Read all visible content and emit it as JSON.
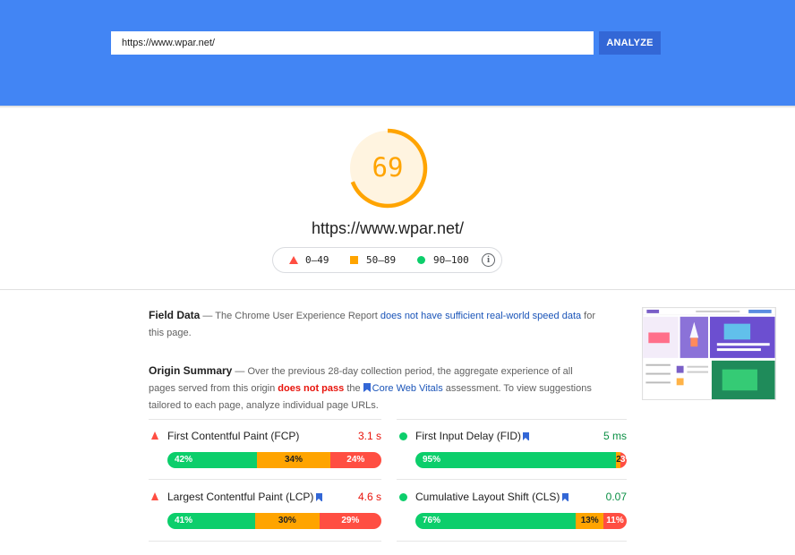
{
  "search": {
    "url_value": "https://www.wpar.net/",
    "analyze_label": "ANALYZE"
  },
  "score": {
    "value": "69",
    "fraction": 0.69,
    "color": "#ffa400",
    "track_color": "#fff4e0"
  },
  "page_url": "https://www.wpar.net/",
  "legend": {
    "poor_range": "0–49",
    "average_range": "50–89",
    "good_range": "90–100",
    "info_glyph": "i"
  },
  "field_data": {
    "title": "Field Data",
    "text_before": " — The Chrome User Experience Report ",
    "link_text": "does not have sufficient real-world speed data",
    "text_after": " for this page."
  },
  "origin_summary": {
    "title": "Origin Summary",
    "text_before": " — Over the previous 28-day collection period, the aggregate experience of all pages served from this origin ",
    "fail_text": "does not pass",
    "text_middle": " the ",
    "cwv_link": "Core Web Vitals",
    "text_after": " assessment. To view suggestions tailored to each page, analyze individual page URLs."
  },
  "metrics": {
    "fcp": {
      "label": "First Contentful Paint (FCP)",
      "value": "3.1 s",
      "status_icon": "triangle-icon",
      "good": "42%",
      "average": "34%",
      "poor": "24%",
      "good_pct": 42,
      "average_pct": 34,
      "poor_pct": 24
    },
    "fid": {
      "label": "First Input Delay (FID)",
      "value": "5 ms",
      "status_icon": "circle-icon",
      "good": "95%",
      "average": "2%",
      "poor": "3%",
      "good_pct": 95,
      "average_pct": 2,
      "poor_pct": 3
    },
    "lcp": {
      "label": "Largest Contentful Paint (LCP)",
      "value": "4.6 s",
      "status_icon": "triangle-icon",
      "good": "41%",
      "average": "30%",
      "poor": "29%",
      "good_pct": 41,
      "average_pct": 30,
      "poor_pct": 29
    },
    "cls": {
      "label": "Cumulative Layout Shift (CLS)",
      "value": "0.07",
      "status_icon": "circle-icon",
      "good": "76%",
      "average": "13%",
      "poor": "11%",
      "good_pct": 76,
      "average_pct": 13,
      "poor_pct": 11
    }
  },
  "colors": {
    "header": "#4285f4",
    "button": "#3367d6",
    "good": "#0cce6b",
    "average": "#ffa400",
    "poor": "#ff4e42",
    "good_text": "#0a8f44",
    "poor_text": "#e8140c",
    "link": "#1a54b8"
  }
}
